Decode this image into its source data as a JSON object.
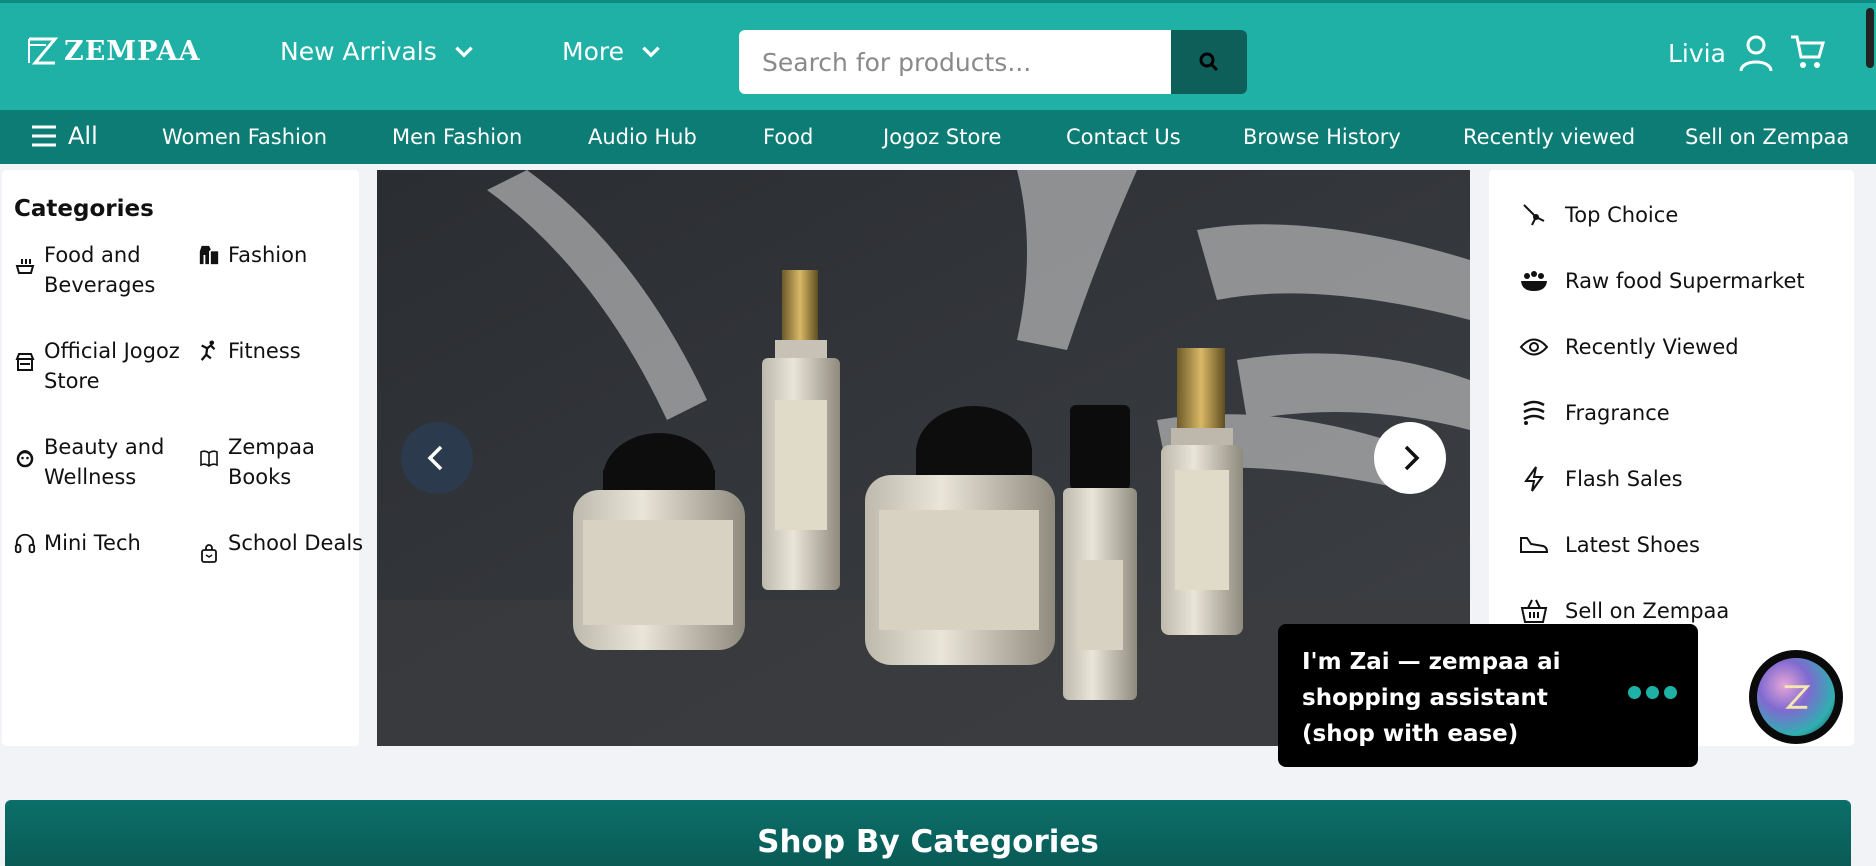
{
  "brand": {
    "name": "ZEMPAA"
  },
  "header": {
    "nav": [
      {
        "label": "New Arrivals"
      },
      {
        "label": "More"
      }
    ],
    "search": {
      "placeholder": "Search for products..."
    },
    "user": {
      "name": "Livia"
    }
  },
  "subnav": {
    "all_label": "All",
    "items": [
      "Women Fashion",
      "Men Fashion",
      "Audio Hub",
      "Food",
      "Jogoz Store",
      "Contact Us",
      "Browse History",
      "Recently viewed",
      "Sell on Zempaa"
    ]
  },
  "categories": {
    "title": "Categories",
    "items": [
      {
        "label": "Food and Beverages",
        "icon": "food-icon"
      },
      {
        "label": "Fashion",
        "icon": "fashion-icon"
      },
      {
        "label": "Official Jogoz Store",
        "icon": "store-icon"
      },
      {
        "label": "Fitness",
        "icon": "fitness-icon"
      },
      {
        "label": "Beauty and Wellness",
        "icon": "beauty-icon"
      },
      {
        "label": "Zempaa Books",
        "icon": "book-icon"
      },
      {
        "label": "Mini Tech",
        "icon": "headphones-icon"
      },
      {
        "label": "School Deals",
        "icon": "bag-icon"
      }
    ]
  },
  "quick_links": [
    {
      "label": "Top Choice",
      "icon": "top-choice-icon"
    },
    {
      "label": "Raw food Supermarket",
      "icon": "raw-food-icon"
    },
    {
      "label": "Recently Viewed",
      "icon": "eye-icon"
    },
    {
      "label": "Fragrance",
      "icon": "fragrance-icon"
    },
    {
      "label": "Flash Sales",
      "icon": "lightning-icon"
    },
    {
      "label": "Latest Shoes",
      "icon": "shoe-icon"
    },
    {
      "label": "Sell on Zempaa",
      "icon": "basket-icon"
    }
  ],
  "assistant": {
    "message": "I'm Zai — zempaa ai shopping assistant (shop with ease)"
  },
  "sections": {
    "shop_by_categories": "Shop By Categories"
  },
  "colors": {
    "primary": "#1fb0a6",
    "secondary": "#0d7c75",
    "dark": "#0e5e59"
  }
}
